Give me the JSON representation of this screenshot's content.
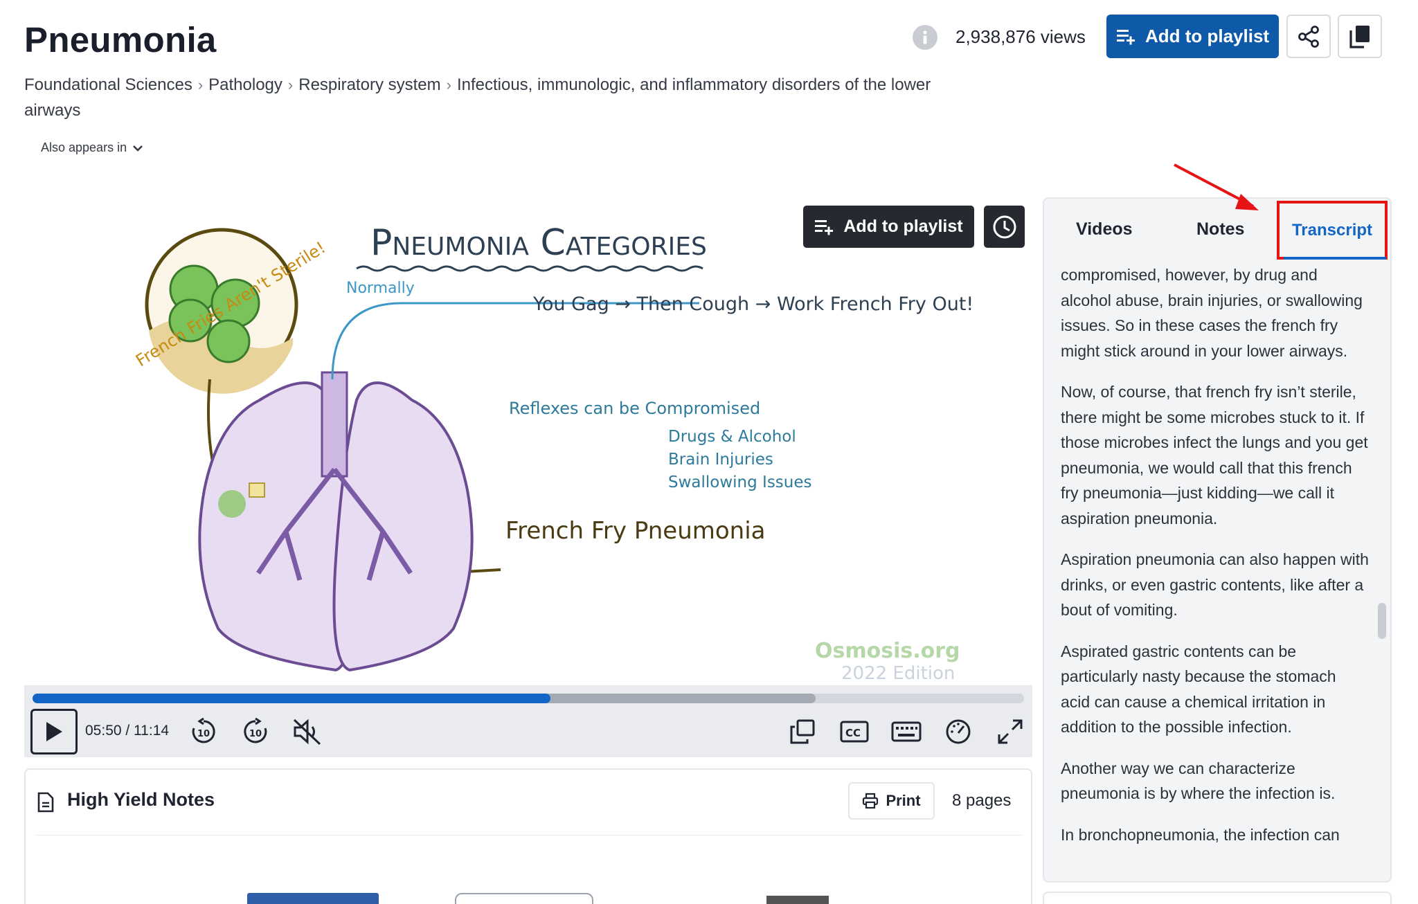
{
  "header": {
    "title": "Pneumonia",
    "views": "2,938,876 views",
    "add_to_playlist": "Add to playlist"
  },
  "breadcrumb": [
    "Foundational Sciences",
    "Pathology",
    "Respiratory system",
    "Infectious, immunologic, and inflammatory disorders of the lower airways"
  ],
  "also_appears": "Also appears in",
  "video": {
    "overlay_playlist": "Add to playlist",
    "art": {
      "title": "Pneumonia Categories",
      "circle_label": "French Fries Aren't Sterile!",
      "normally": "Normally",
      "reflex_line": "You Gag → Then Cough → Work French Fry Out!",
      "compromised": "Reflexes can be Compromised",
      "causes": [
        "Drugs & Alcohol",
        "Brain Injuries",
        "Swallowing Issues"
      ],
      "result": "French Fry Pneumonia",
      "watermark": "Osmosis.org",
      "watermark_edition": "2022 Edition"
    },
    "time": "05:50 / 11:14",
    "progress_played": 0.522,
    "progress_buffered": 0.79
  },
  "notes": {
    "title": "High Yield Notes",
    "print": "Print",
    "pages": "8 pages"
  },
  "panel": {
    "tabs": [
      "Videos",
      "Notes",
      "Transcript"
    ],
    "active_tab": "Transcript",
    "transcript": [
      "compromised, however, by drug and alcohol abuse, brain injuries, or swallowing issues. So in these cases the french fry might stick around in your lower airways.",
      "Now, of course, that french fry isn’t sterile, there might be some microbes stuck to it. If those microbes infect the lungs and you get pneumonia, we would call that this french fry pneumonia—just kidding—we call it aspiration pneumonia.",
      "Aspiration pneumonia can also happen with drinks, or even gastric contents, like after a bout of vomiting.",
      "Aspirated gastric contents can be particularly nasty because the stomach acid can cause a chemical irritation in addition to the possible infection.",
      "Another way we can characterize pneumonia is by where the infection is.",
      "In bronchopneumonia, the infection can"
    ]
  },
  "colors": {
    "primary": "#0f5aa8",
    "progress": "#1466c6",
    "highlight": "#e61414"
  }
}
